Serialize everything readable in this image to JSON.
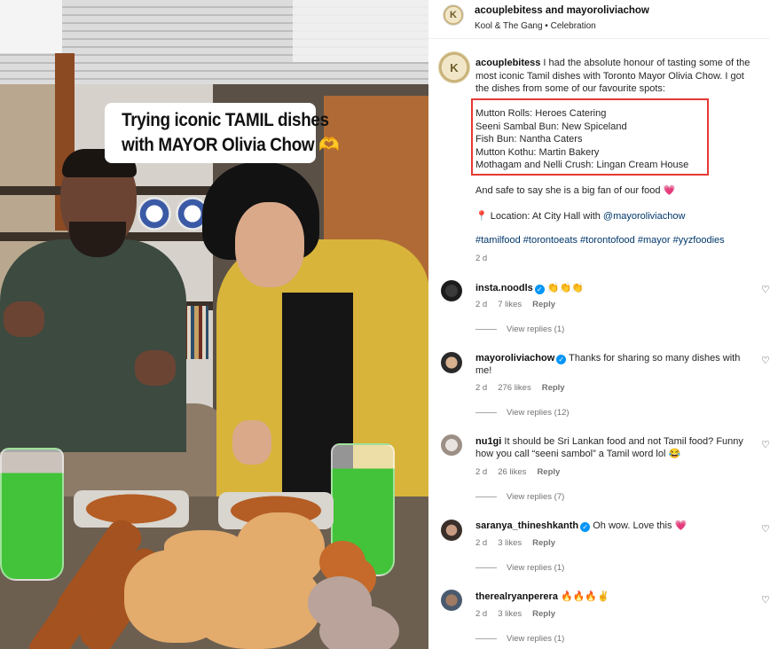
{
  "video": {
    "caption_line1": "Trying iconic TAMIL dishes",
    "caption_line2": "with MAYOR Olivia Chow 🫶"
  },
  "header": {
    "author": "acouplebitess",
    "and_text": "and",
    "coauthor": "mayoroliviachow",
    "audio": "Kool & The Gang • Celebration"
  },
  "post": {
    "username": "acouplebitess",
    "intro": "I had the absolute honour of tasting some of the most iconic Tamil dishes with Toronto Mayor Olivia Chow. I got the dishes from some of our favourite spots:",
    "spots": [
      "Mutton Rolls: Heroes Catering",
      "Seeni Sambal Bun: New Spiceland",
      "Fish Bun: Nantha Caters",
      "Mutton Kothu: Martin Bakery",
      "Mothagam and Nelli Crush: Lingan Cream House"
    ],
    "fan_line": "And safe to say she is a big fan of our food 💗",
    "location_prefix": "📍 Location: At City Hall with ",
    "location_mention": "@mayoroliviachow",
    "hashtags": "#tamilfood #torontoeats #torontofood #mayor #yyzfoodies",
    "age": "2 d"
  },
  "comments": [
    {
      "username": "insta.noodls",
      "verified": "✓",
      "text": "👏👏👏",
      "age": "2 d",
      "likes": "7 likes",
      "reply": "Reply",
      "view_replies": "View replies (1)"
    },
    {
      "username": "mayoroliviachow",
      "verified": "✓",
      "text": "Thanks for sharing so many dishes with me!",
      "age": "2 d",
      "likes": "276 likes",
      "reply": "Reply",
      "view_replies": "View replies (12)"
    },
    {
      "username": "nu1gi",
      "text": "It should be Sri Lankan food and not Tamil food? Funny how you call “seeni sambol” a Tamil word lol 😂",
      "age": "2 d",
      "likes": "26 likes",
      "reply": "Reply",
      "view_replies": "View replies (7)"
    },
    {
      "username": "saranya_thineshkanth",
      "verified": "✓",
      "text": "Oh wow. Love this 💗",
      "age": "2 d",
      "likes": "3 likes",
      "reply": "Reply",
      "view_replies": "View replies (1)"
    },
    {
      "username": "therealryanperera",
      "text": "🔥🔥🔥✌",
      "age": "2 d",
      "likes": "3 likes",
      "reply": "Reply",
      "view_replies": "View replies (1)"
    }
  ],
  "icons": {
    "like": "heart-outline-icon",
    "verified": "verified-badge-icon"
  },
  "colors": {
    "link": "#00376b",
    "verified": "#0095f6",
    "highlight_box": "#e53935"
  }
}
